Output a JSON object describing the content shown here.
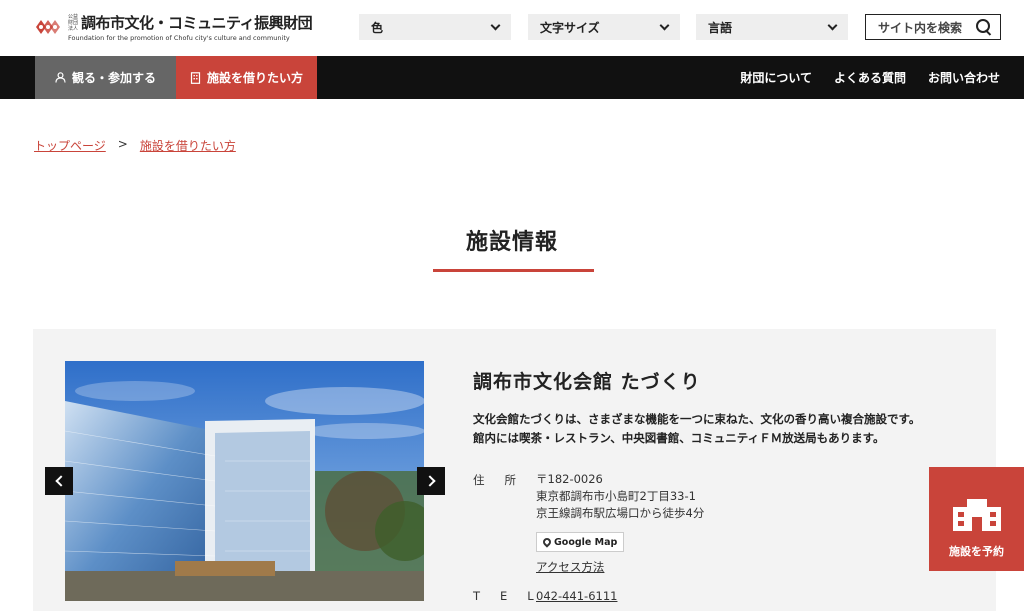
{
  "header": {
    "logo_tiny": "公益財団法人",
    "logo_title": "調布市文化・コミュニティ振興財団",
    "logo_subtitle": "Foundation for the promotion of Chofu city's culture and community",
    "color_label": "色",
    "font_size_label": "文字サイズ",
    "language_label": "言語",
    "search_label": "サイト内を検索"
  },
  "nav": {
    "watch_label": "観る・参加する",
    "rent_label": "施設を借りたい方",
    "about_label": "財団について",
    "faq_label": "よくある質問",
    "contact_label": "お問い合わせ"
  },
  "breadcrumb": {
    "home": "トップページ",
    "separator": ">",
    "current": "施設を借りたい方"
  },
  "page": {
    "title": "施設情報"
  },
  "facility": {
    "name": "調布市文化会館 たづくり",
    "desc_line1": "文化会館たづくりは、さまざまな機能を一つに束ねた、文化の香り高い複合施設です。",
    "desc_line2": "館内には喫茶・レストラン、中央図書館、コミュニティＦＭ放送局もあります。",
    "address_label": "住所",
    "postal": "〒182-0026",
    "address": "東京都調布市小島町2丁目33-1",
    "access_note": "京王線調布駅広場口から徒歩4分",
    "gmap_label": "Google Map",
    "access_link": "アクセス方法",
    "tel_label": "TEL",
    "tel": "042-441-6111"
  },
  "reserve": {
    "label": "施設を予約"
  },
  "colors": {
    "accent": "#c9443a",
    "nav_bg": "#111111",
    "nav_inactive": "#666666",
    "card_bg": "#f3f3f3"
  }
}
